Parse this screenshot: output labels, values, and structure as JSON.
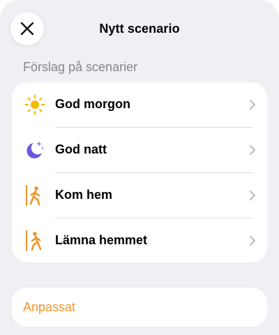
{
  "header": {
    "title": "Nytt scenario",
    "close_icon": "close-icon"
  },
  "suggestions": {
    "section_title": "Förslag på scenarier",
    "items": [
      {
        "label": "God morgon",
        "icon": "sun-icon"
      },
      {
        "label": "God natt",
        "icon": "moon-stars-icon"
      },
      {
        "label": "Kom hem",
        "icon": "walk-in-icon"
      },
      {
        "label": "Lämna hemmet",
        "icon": "walk-out-icon"
      }
    ]
  },
  "custom": {
    "label": "Anpassat"
  },
  "colors": {
    "background": "#efeff4",
    "card": "#ffffff",
    "accent": "#f0952a",
    "sun": "#f6b800",
    "moon": "#6d55e0",
    "walker": "#f0952a",
    "muted_text": "#86868b",
    "chevron": "#b8b8bd"
  }
}
